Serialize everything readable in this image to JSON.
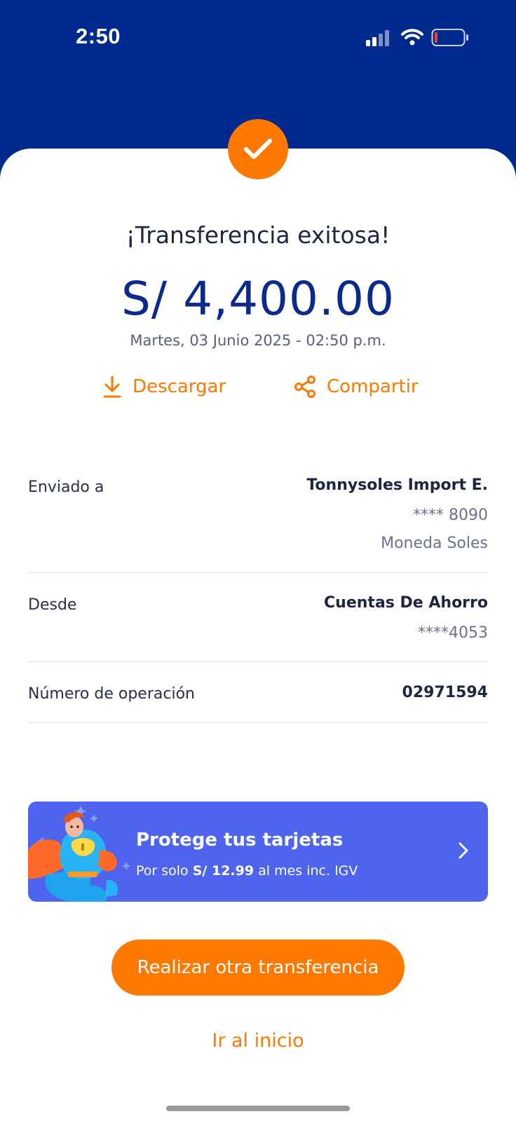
{
  "status_bar": {
    "time": "2:50",
    "icons": [
      "signal-icon",
      "wifi-icon",
      "battery-low-icon"
    ]
  },
  "colors": {
    "header_blue": "#002a8d",
    "accent_orange": "#ff7800",
    "amount_blue": "#0c2a8c",
    "promo_blue": "#4e64ee"
  },
  "receipt": {
    "title": "¡Transferencia exitosa!",
    "amount": "S/ 4,400.00",
    "datetime": "Martes, 03 Junio 2025 - 02:50 p.m.",
    "actions": {
      "download": "Descargar",
      "share": "Compartir"
    }
  },
  "details": {
    "sent_to": {
      "label": "Enviado a",
      "name": "Tonnysoles Import E.",
      "account": "**** 8090",
      "currency": "Moneda Soles"
    },
    "from": {
      "label": "Desde",
      "name": "Cuentas De Ahorro",
      "account": "****4053"
    },
    "operation": {
      "label": "Número de operación",
      "number": "02971594"
    }
  },
  "promo": {
    "title": "Protege tus tarjetas",
    "sub_prefix": "Por solo",
    "sub_price": "S/ 12.99",
    "sub_suffix": "al mes inc. IGV"
  },
  "buttons": {
    "primary": "Realizar otra transferencia",
    "secondary": "Ir al inicio"
  }
}
